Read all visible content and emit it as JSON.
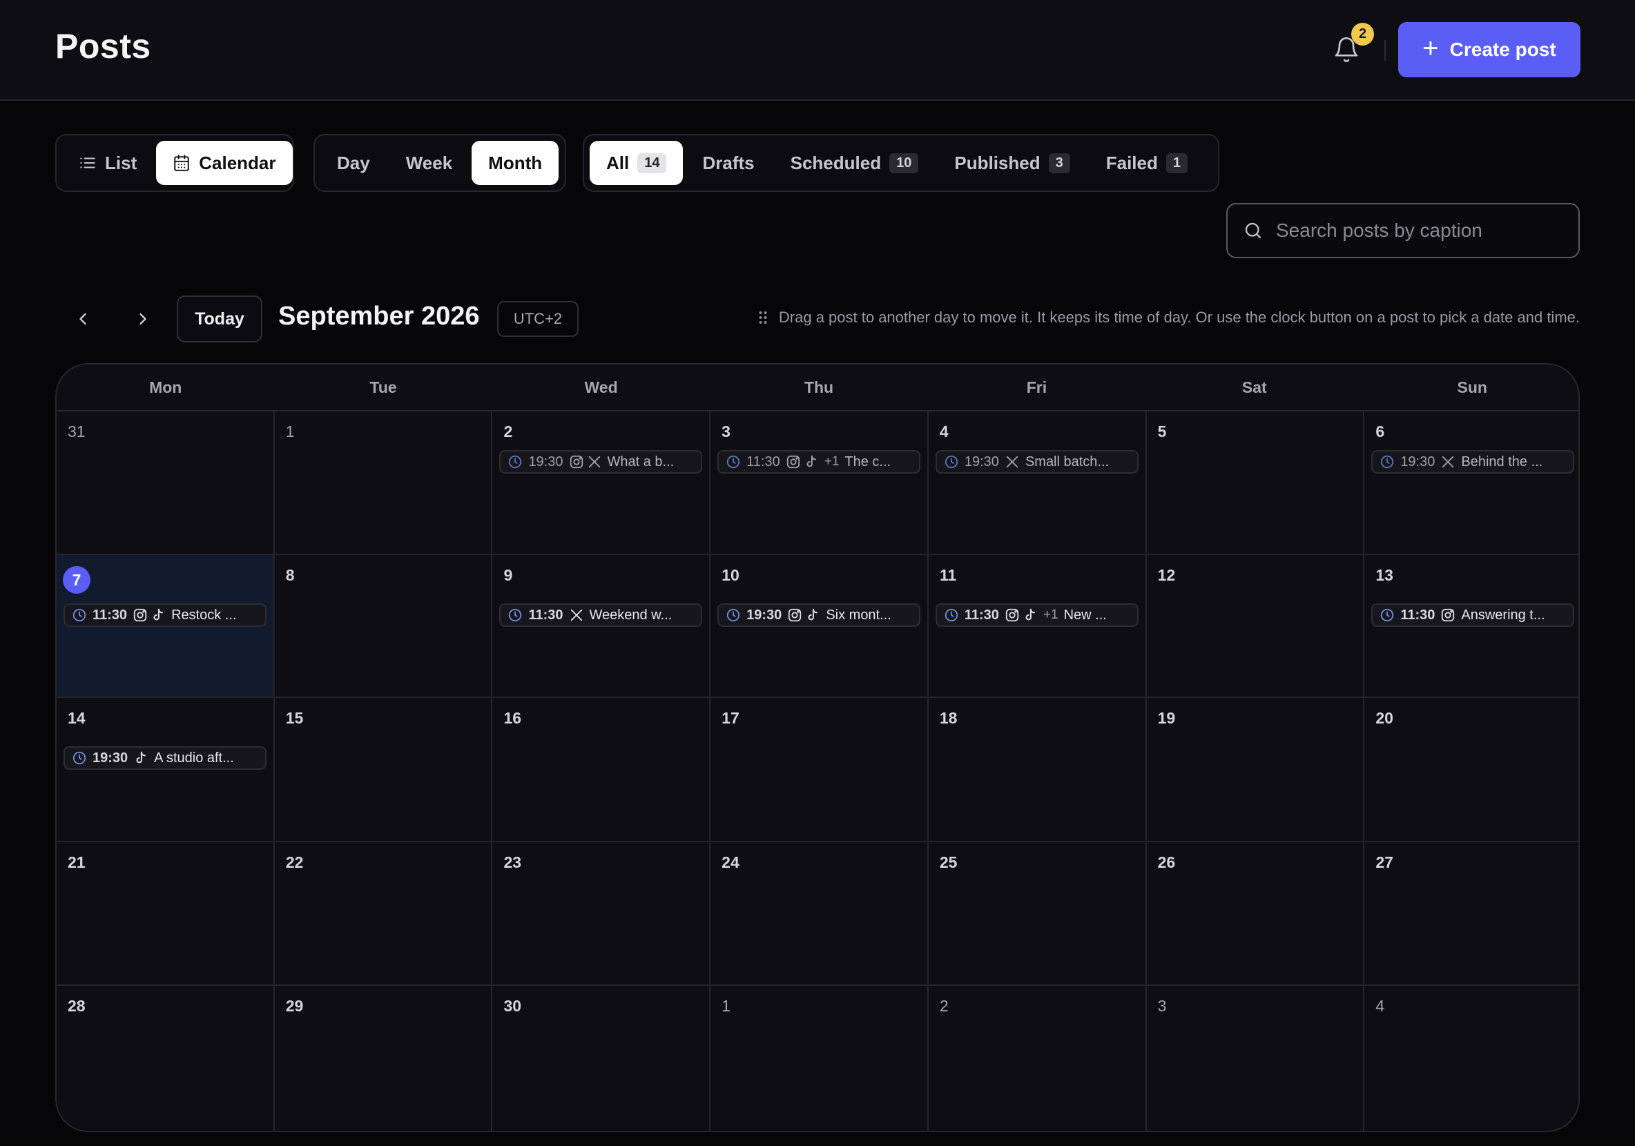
{
  "header": {
    "title": "Posts",
    "notification_count": "2",
    "create_label": "Create post"
  },
  "view_toggle": [
    {
      "label": "List",
      "icon": "list-icon",
      "active": false
    },
    {
      "label": "Calendar",
      "icon": "calendar-icon",
      "active": true
    }
  ],
  "range_toggle": [
    {
      "label": "Day",
      "active": false
    },
    {
      "label": "Week",
      "active": false
    },
    {
      "label": "Month",
      "active": true
    }
  ],
  "status_filters": [
    {
      "label": "All",
      "count": "14",
      "active": true
    },
    {
      "label": "Drafts",
      "count": "",
      "active": false
    },
    {
      "label": "Scheduled",
      "count": "10",
      "active": false
    },
    {
      "label": "Published",
      "count": "3",
      "active": false
    },
    {
      "label": "Failed",
      "count": "1",
      "active": false
    }
  ],
  "search": {
    "placeholder": "Search posts by caption",
    "value": ""
  },
  "calendar_nav": {
    "today_label": "Today",
    "month_title": "September 2026",
    "timezone": "UTC+2",
    "hint": "Drag a post to another day to move it. It keeps its time of day. Or use the clock button on a post to pick a date and time."
  },
  "weekdays": [
    "Mon",
    "Tue",
    "Wed",
    "Thu",
    "Fri",
    "Sat",
    "Sun"
  ],
  "weeks": [
    [
      {
        "day": "31",
        "muted": true,
        "posts": []
      },
      {
        "day": "1",
        "muted": true,
        "posts": []
      },
      {
        "day": "2",
        "muted": false,
        "posts": [
          {
            "time": "19:30",
            "platforms": [
              "instagram",
              "x"
            ],
            "more": "",
            "caption": "What a b...",
            "state": "published"
          }
        ]
      },
      {
        "day": "3",
        "muted": false,
        "posts": [
          {
            "time": "11:30",
            "platforms": [
              "instagram",
              "tiktok"
            ],
            "more": "+1",
            "caption": "The c...",
            "state": "published"
          }
        ]
      },
      {
        "day": "4",
        "muted": false,
        "posts": [
          {
            "time": "19:30",
            "platforms": [
              "x"
            ],
            "more": "",
            "caption": "Small batch...",
            "state": "published"
          }
        ]
      },
      {
        "day": "5",
        "muted": false,
        "posts": []
      },
      {
        "day": "6",
        "muted": false,
        "posts": [
          {
            "time": "19:30",
            "platforms": [
              "x"
            ],
            "more": "",
            "caption": "Behind the ...",
            "state": "published"
          }
        ]
      }
    ],
    [
      {
        "day": "7",
        "today": true,
        "posts": [
          {
            "time": "11:30",
            "platforms": [
              "instagram",
              "tiktok"
            ],
            "more": "",
            "caption": "Restock ...",
            "state": "scheduled"
          }
        ]
      },
      {
        "day": "8",
        "posts": []
      },
      {
        "day": "9",
        "posts": [
          {
            "time": "11:30",
            "platforms": [
              "x"
            ],
            "more": "",
            "caption": "Weekend w...",
            "state": "scheduled"
          }
        ]
      },
      {
        "day": "10",
        "posts": [
          {
            "time": "19:30",
            "platforms": [
              "instagram",
              "tiktok"
            ],
            "more": "",
            "caption": "Six mont...",
            "state": "scheduled"
          }
        ]
      },
      {
        "day": "11",
        "posts": [
          {
            "time": "11:30",
            "platforms": [
              "instagram",
              "tiktok"
            ],
            "more": "+1",
            "caption": "New ...",
            "state": "scheduled"
          }
        ]
      },
      {
        "day": "12",
        "posts": []
      },
      {
        "day": "13",
        "posts": [
          {
            "time": "11:30",
            "platforms": [
              "instagram"
            ],
            "more": "",
            "caption": "Answering t...",
            "state": "scheduled"
          }
        ]
      }
    ],
    [
      {
        "day": "14",
        "posts": [
          {
            "time": "19:30",
            "platforms": [
              "tiktok"
            ],
            "more": "",
            "caption": "A studio aft...",
            "state": "scheduled"
          }
        ]
      },
      {
        "day": "15",
        "posts": []
      },
      {
        "day": "16",
        "posts": []
      },
      {
        "day": "17",
        "posts": []
      },
      {
        "day": "18",
        "posts": []
      },
      {
        "day": "19",
        "posts": []
      },
      {
        "day": "20",
        "posts": []
      }
    ],
    [
      {
        "day": "21",
        "posts": []
      },
      {
        "day": "22",
        "posts": []
      },
      {
        "day": "23",
        "posts": []
      },
      {
        "day": "24",
        "posts": []
      },
      {
        "day": "25",
        "posts": []
      },
      {
        "day": "26",
        "posts": []
      },
      {
        "day": "27",
        "posts": []
      }
    ],
    [
      {
        "day": "28",
        "posts": []
      },
      {
        "day": "29",
        "posts": []
      },
      {
        "day": "30",
        "posts": []
      },
      {
        "day": "1",
        "muted": true,
        "posts": []
      },
      {
        "day": "2",
        "muted": true,
        "posts": []
      },
      {
        "day": "3",
        "muted": true,
        "posts": []
      },
      {
        "day": "4",
        "muted": true,
        "posts": []
      }
    ]
  ],
  "colors": {
    "accent": "#5b5ef4",
    "badge": "#f2c94c",
    "clock": "#6f8fe0",
    "today_bg": "#121a2e"
  }
}
